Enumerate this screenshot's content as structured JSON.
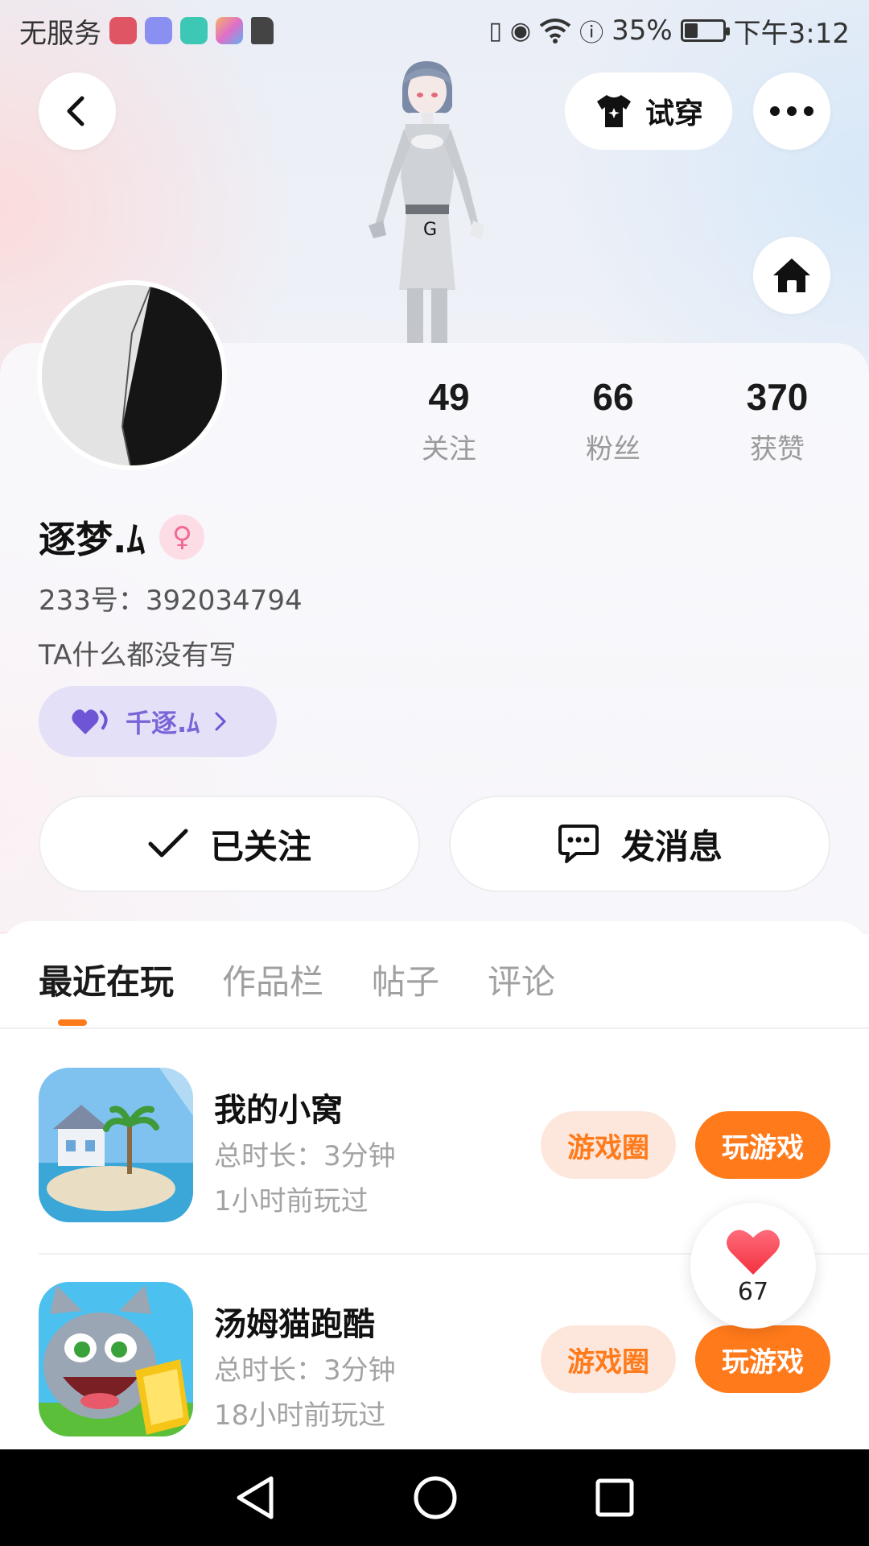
{
  "status_bar": {
    "carrier": "无服务",
    "battery": "35%",
    "battery_level": 0.35,
    "time": "下午3:12"
  },
  "header": {
    "back_icon": "back-arrow-icon",
    "try_on_label": "试穿",
    "more_icon": "more-dots-icon",
    "home_icon": "home-icon"
  },
  "profile": {
    "stats": [
      {
        "value": "49",
        "label": "关注"
      },
      {
        "value": "66",
        "label": "粉丝"
      },
      {
        "value": "370",
        "label": "获赞"
      }
    ],
    "username": "逐梦.ﾑ",
    "gender_icon": "female-icon",
    "uid": "233号：392034794",
    "bio": "TA什么都没有写",
    "cp_tag": "千逐.ﾑ",
    "follow_label": "已关注",
    "message_label": "发消息"
  },
  "tabs": [
    "最近在玩",
    "作品栏",
    "帖子",
    "评论"
  ],
  "games": [
    {
      "title": "我的小窝",
      "duration": "总时长：3分钟",
      "last_played": "1小时前玩过",
      "circle_label": "游戏圈",
      "play_label": "玩游戏"
    },
    {
      "title": "汤姆猫跑酷",
      "duration": "总时长：3分钟",
      "last_played": "18小时前玩过",
      "circle_label": "游戏圈",
      "play_label": "玩游戏"
    }
  ],
  "like_fab": {
    "count": "67"
  },
  "colors": {
    "accent": "#ff7a1a",
    "accent_light": "#fde7dc",
    "cp_purple": "#7a64d8"
  }
}
